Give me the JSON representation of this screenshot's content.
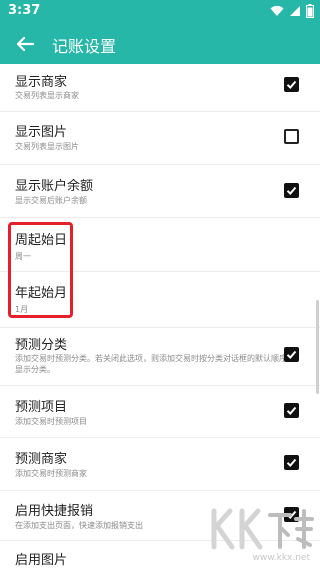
{
  "status_bar": {
    "time": "3:37",
    "icons": [
      "wifi-icon",
      "signal-icon",
      "battery-icon"
    ]
  },
  "app_bar": {
    "title": "记账设置",
    "back_icon": "arrow-left-icon"
  },
  "settings": [
    {
      "title": "显示商家",
      "subtitle": "交易列表显示商家",
      "checked": true
    },
    {
      "title": "显示图片",
      "subtitle": "交易列表显示图片",
      "checked": false
    },
    {
      "title": "显示账户余额",
      "subtitle": "显示交易后账户余额",
      "checked": true
    },
    {
      "title": "周起始日",
      "subtitle": "周一"
    },
    {
      "title": "年起始月",
      "subtitle": "1月"
    },
    {
      "title": "预测分类",
      "subtitle": "添加交易时预测分类。若关闭此选项，则添加交易时按分类对话框的默认顺序显示分类。",
      "checked": true
    },
    {
      "title": "预测项目",
      "subtitle": "添加交易时预测项目",
      "checked": true
    },
    {
      "title": "预测商家",
      "subtitle": "添加交易时预测商家",
      "checked": true
    },
    {
      "title": "启用快捷报销",
      "subtitle": "在添加支出页面，快速添加报销支出",
      "checked": true
    },
    {
      "title": "启用图片"
    }
  ],
  "watermark": {
    "site": "www.kkx.net"
  },
  "colors": {
    "primary": "#26b7a8",
    "highlight": "#e5202a",
    "checkbox": "#111111"
  }
}
